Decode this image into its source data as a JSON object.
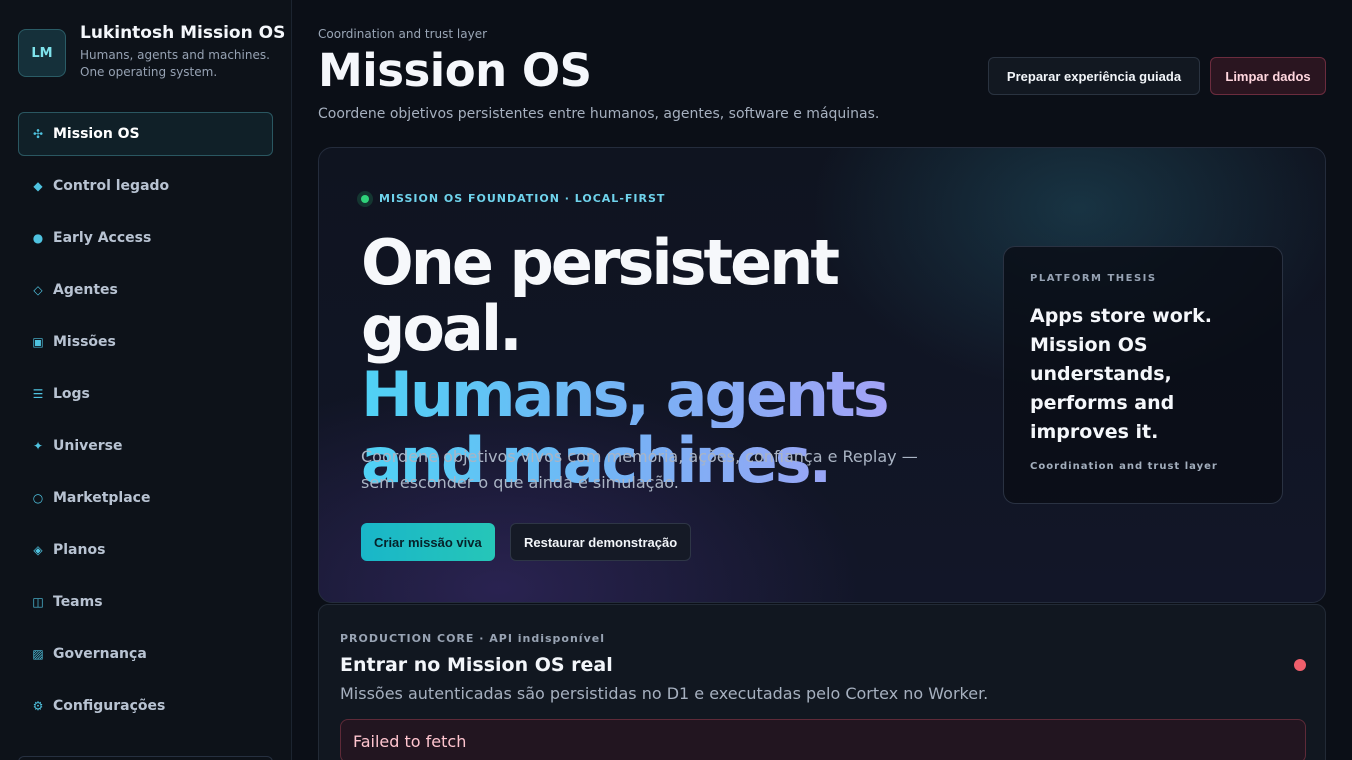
{
  "brand": {
    "logo": "LM",
    "title": "Lukintosh Mission OS",
    "subtitle": "Humans, agents and machines. One operating system."
  },
  "nav": [
    {
      "label": "Mission OS",
      "icon": "plus-cross-icon",
      "glyph": "✣"
    },
    {
      "label": "Control legado",
      "icon": "diamond-filled-icon",
      "glyph": "◆"
    },
    {
      "label": "Early Access",
      "icon": "dot-icon",
      "glyph": "●"
    },
    {
      "label": "Agentes",
      "icon": "diamond-outline-icon",
      "glyph": "◇"
    },
    {
      "label": "Missões",
      "icon": "square-icon",
      "glyph": "▣"
    },
    {
      "label": "Logs",
      "icon": "lines-icon",
      "glyph": "☰"
    },
    {
      "label": "Universe",
      "icon": "sparkle-icon",
      "glyph": "✦"
    },
    {
      "label": "Marketplace",
      "icon": "circle-outline-icon",
      "glyph": "○"
    },
    {
      "label": "Planos",
      "icon": "diamond-dot-icon",
      "glyph": "◈"
    },
    {
      "label": "Teams",
      "icon": "columns-icon",
      "glyph": "◫"
    },
    {
      "label": "Governança",
      "icon": "hatch-icon",
      "glyph": "▨"
    },
    {
      "label": "Configurações",
      "icon": "gear-icon",
      "glyph": "⚙"
    }
  ],
  "header": {
    "eyebrow": "Coordination and trust layer",
    "title": "Mission OS",
    "subtitle": "Coordene objetivos persistentes entre humanos, agentes, software e máquinas.",
    "guide_button": "Preparar experiência guiada",
    "clear_button": "Limpar dados"
  },
  "hero": {
    "tag": "MISSION OS FOUNDATION · LOCAL-FIRST",
    "headline_1": "One persistent goal.",
    "headline_2": "Humans, agents",
    "headline_3": "and machines.",
    "description": "Coordene objetivos vivos com memória, ações, confiança e Replay — sem esconder o que ainda é simulação.",
    "create_button": "Criar missão viva",
    "restore_button": "Restaurar demonstração",
    "thesis_label": "PLATFORM THESIS",
    "thesis_text": "Apps store work. Mission OS understands, performs and improves it.",
    "thesis_footer": "Coordination and trust layer"
  },
  "core": {
    "eyebrow": "PRODUCTION CORE · API indisponível",
    "title": "Entrar no Mission OS real",
    "subtitle": "Missões autenticadas são persistidas no D1 e executadas pelo Cortex no Worker.",
    "error": "Failed to fetch",
    "status_color": "#ef5f6c"
  }
}
